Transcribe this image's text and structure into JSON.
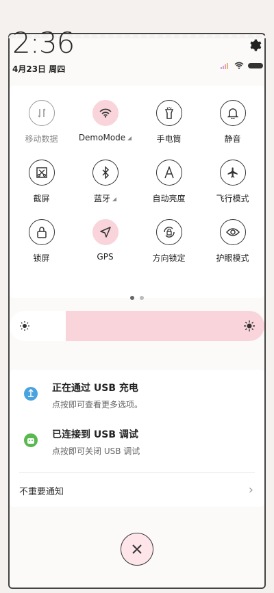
{
  "status": {
    "time": "2:36",
    "date": "4月23日 周四"
  },
  "tiles": [
    {
      "label": "移动数据",
      "icon": "mobile-data-icon"
    },
    {
      "label": "DemoMode",
      "icon": "wifi-icon",
      "expand": true
    },
    {
      "label": "手电筒",
      "icon": "flashlight-icon"
    },
    {
      "label": "静音",
      "icon": "bell-icon"
    },
    {
      "label": "截屏",
      "icon": "screenshot-icon"
    },
    {
      "label": "蓝牙",
      "icon": "bluetooth-icon",
      "expand": true
    },
    {
      "label": "自动亮度",
      "icon": "auto-brightness-icon"
    },
    {
      "label": "飞行模式",
      "icon": "airplane-icon"
    },
    {
      "label": "锁屏",
      "icon": "lock-icon"
    },
    {
      "label": "GPS",
      "icon": "location-icon"
    },
    {
      "label": "方向锁定",
      "icon": "rotation-lock-icon"
    },
    {
      "label": "护眼模式",
      "icon": "eye-icon"
    }
  ],
  "brightness": {
    "level": 0.22
  },
  "notifications": [
    {
      "title": "正在通过 USB 充电",
      "subtitle": "点按即可查看更多选项。"
    },
    {
      "title": "已连接到 USB 调试",
      "subtitle": "点按即可关闭 USB 调试"
    }
  ],
  "unimportant_label": "不重要通知",
  "colors": {
    "accent_pink": "#f9d4da"
  }
}
